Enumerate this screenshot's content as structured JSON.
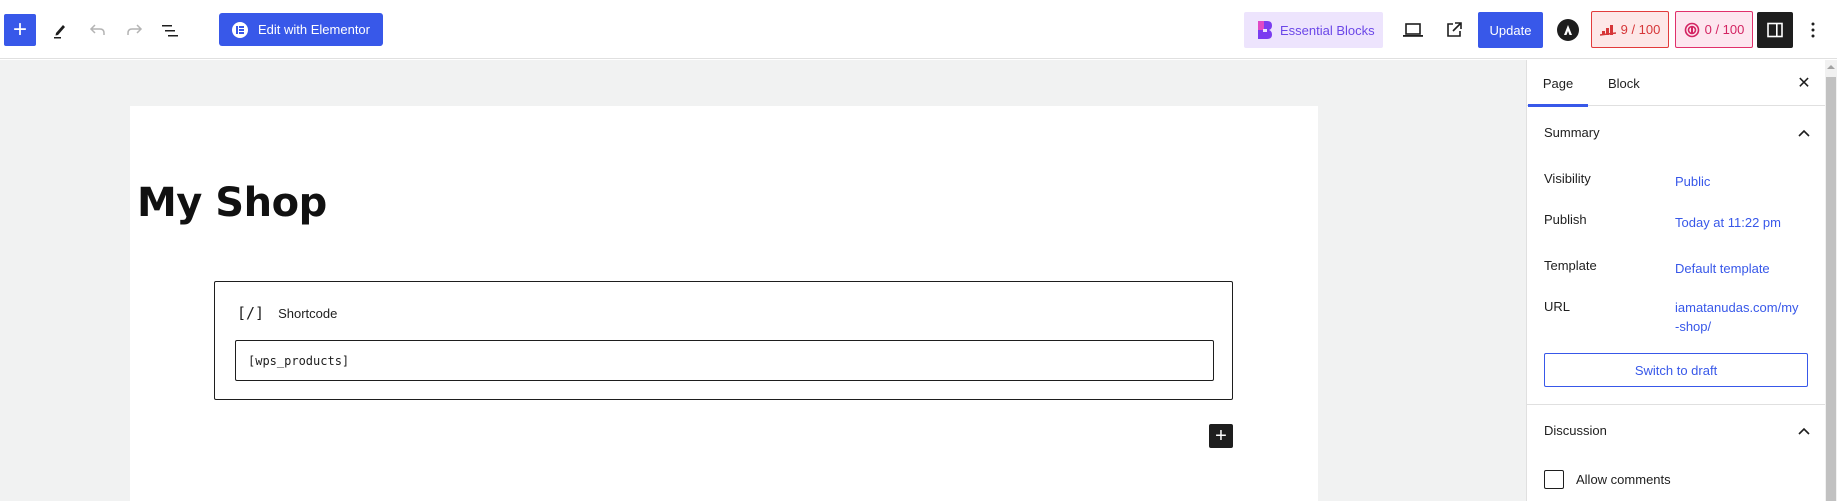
{
  "header": {
    "inserter_label": "+",
    "elementor_label": "Edit with Elementor",
    "essential_blocks_label": "Essential Blocks",
    "update_label": "Update",
    "seo_score": "9 / 100",
    "readability_score": "0 / 100",
    "icons": {
      "inserter": "plus-icon",
      "tools": "pencil-icon",
      "undo": "undo-icon",
      "redo": "redo-icon",
      "outline": "list-view-icon",
      "preview": "laptop-icon",
      "view_post": "external-link-icon",
      "astra": "astra-logo-icon",
      "settings": "sidebar-toggle-icon",
      "options": "kebab-menu-icon"
    },
    "colors": {
      "accent": "#3858e9",
      "essential_blocks_bg": "#ede4fd",
      "seo_score": "#d63638",
      "readability_score": "#d32462"
    }
  },
  "canvas": {
    "title": "My Shop",
    "shortcode_block": {
      "icon": "[/]",
      "label": "Shortcode",
      "value": "[wps_products]"
    },
    "add_block_label": "+"
  },
  "sidebar": {
    "tabs": [
      {
        "label": "Page",
        "active": true
      },
      {
        "label": "Block",
        "active": false
      }
    ],
    "close_label": "✕",
    "summary": {
      "title": "Summary",
      "rows": [
        {
          "label": "Visibility",
          "value": "Public"
        },
        {
          "label": "Publish",
          "value": "Today at 11:22 pm"
        },
        {
          "label": "Template",
          "value": "Default template"
        },
        {
          "label": "URL",
          "value": "iamatanudas.com/my-shop/"
        }
      ],
      "switch_to_draft_label": "Switch to draft"
    },
    "discussion": {
      "title": "Discussion",
      "allow_comments_label": "Allow comments",
      "allow_comments_checked": false
    }
  }
}
